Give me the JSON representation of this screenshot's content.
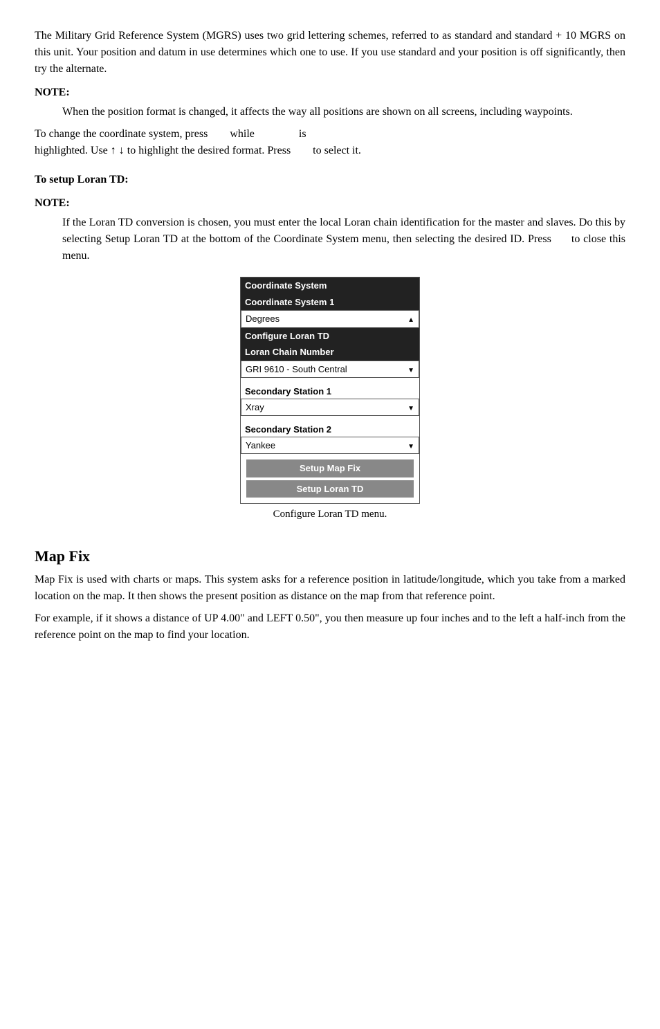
{
  "paragraphs": {
    "intro": "The Military Grid Reference System (MGRS) uses two grid lettering schemes, referred to as standard and standard + 10 MGRS on this unit. Your position and datum in use determines which one to use. If you use standard and your position is off significantly, then try the alternate.",
    "note_heading": "NOTE:",
    "note_text": "When the position format is changed, it affects the way all positions are shown on all screens, including waypoints.",
    "change_coord": "To change the coordinate system, press",
    "change_coord_while": "while",
    "change_coord_is": "is",
    "change_coord2": "highlighted. Use ↑ ↓ to highlight the desired format. Press",
    "change_coord2_end": "to select it.",
    "setup_heading": "To setup Loran TD:",
    "setup_note": "NOTE:",
    "setup_note_text": "If the Loran TD conversion is chosen, you must enter the local Loran chain identification for the master and slaves. Do this by selecting Setup Loran TD at the bottom of the Coordinate System menu, then selecting the desired ID. Press",
    "setup_note_end": "to close this menu.",
    "menu_caption": "Configure Loran TD menu.",
    "map_fix_heading": "Map Fix",
    "map_fix_p1": "Map Fix is used with charts or maps. This system asks for a reference position in latitude/longitude, which you take from a marked location on the map. It then shows the present position as distance on the map from that reference point.",
    "map_fix_p2": "For example, if it shows a distance of UP 4.00\" and LEFT 0.50\", you then measure up four inches and to the left a half-inch from the reference point on the map to find your location."
  },
  "menu": {
    "title": "Coordinate System",
    "row1": "Coordinate System 1",
    "row2_label": "Degrees",
    "row3": "Configure Loran TD",
    "row4": "Loran Chain Number",
    "row5": "GRI 9610 - South Central",
    "row6_label": "Secondary Station 1",
    "row6_value": "Xray",
    "row7_label": "Secondary Station 2",
    "row7_value": "Yankee",
    "btn1": "Setup Map Fix",
    "btn2": "Setup Loran TD"
  }
}
